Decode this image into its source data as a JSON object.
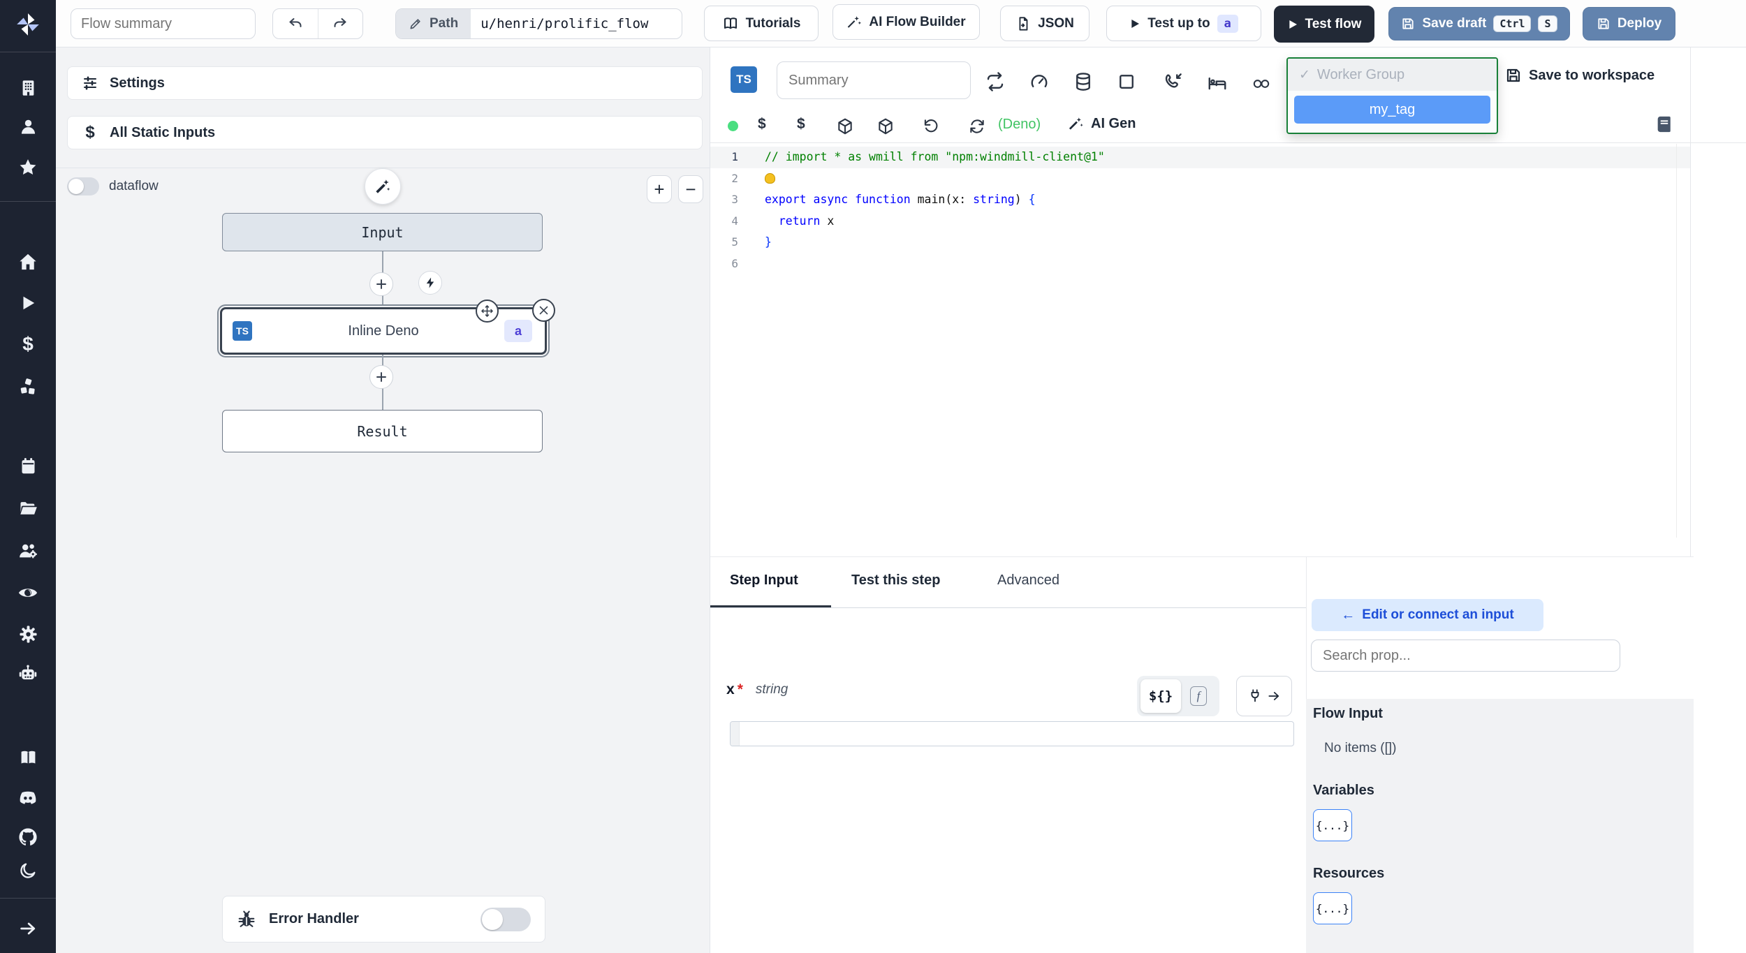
{
  "colors": {
    "sidebar_bg": "#1d2331",
    "ts_badge_blue": "#2f74c0",
    "steel_button": "#6283ae",
    "dark_button": "#222936",
    "selected_tag_blue": "#5b9bf8",
    "worker_group_border": "#188038",
    "deno_green": "#41c464",
    "status_dot_green": "#4ade80",
    "badge_indigo_bg": "#e0e7ff",
    "badge_indigo_text": "#4338ca",
    "edit_connect_bg": "#dbeafe",
    "edit_connect_text": "#1d4ed8"
  },
  "sidebar": {
    "icons": [
      "windmill-logo",
      "building",
      "person",
      "star",
      "home",
      "play",
      "dollar",
      "cubes",
      "calendar",
      "folder",
      "users-settings",
      "eye",
      "gear",
      "robot",
      "book",
      "discord",
      "github",
      "moon",
      "arrow-right"
    ]
  },
  "topbar": {
    "flow_summary_placeholder": "Flow summary",
    "path_label": "Path",
    "path_value": "u/henri/prolific_flow",
    "tutorials_label": "Tutorials",
    "ai_flow_builder_label": "AI Flow Builder",
    "json_label": "JSON",
    "test_up_to_label": "Test up to",
    "test_up_to_badge": "a",
    "test_flow_label": "Test flow",
    "save_draft_label": "Save draft",
    "save_draft_kbd": [
      "Ctrl",
      "S"
    ],
    "deploy_label": "Deploy"
  },
  "flow_panel": {
    "settings_label": "Settings",
    "static_inputs_label": "All Static Inputs",
    "dataflow_label": "dataflow",
    "zoom_in": "+",
    "zoom_out": "−",
    "input_node": "Input",
    "step_node": {
      "lang_badge": "TS",
      "label": "Inline Deno",
      "suffix_badge": "a"
    },
    "result_node": "Result",
    "error_handler_label": "Error Handler"
  },
  "editor": {
    "lang_badge": "TS",
    "summary_placeholder": "Summary",
    "lang_hint": "(Deno)",
    "ai_gen_label": "AI Gen",
    "save_to_workspace_label": "Save to workspace",
    "worker_group": {
      "check": "✓",
      "header": "Worker Group",
      "selected": "my_tag"
    },
    "code": {
      "lines": [
        [
          {
            "c": "cmt",
            "t": "// import * as wmill from \"npm:windmill-client@1\""
          }
        ],
        [
          {
            "c": "bulb",
            "t": ""
          }
        ],
        [
          {
            "c": "kw",
            "t": "export"
          },
          {
            "t": " "
          },
          {
            "c": "kw",
            "t": "async"
          },
          {
            "t": " "
          },
          {
            "c": "kw",
            "t": "function"
          },
          {
            "t": " "
          },
          {
            "t": "main"
          },
          {
            "c": "pun",
            "t": "("
          },
          {
            "t": "x"
          },
          {
            "c": "pun",
            "t": ": "
          },
          {
            "c": "kw",
            "t": "string"
          },
          {
            "c": "pun",
            "t": ")"
          },
          {
            "t": " "
          },
          {
            "c": "brc",
            "t": "{"
          }
        ],
        [
          {
            "t": "  "
          },
          {
            "c": "kw",
            "t": "return"
          },
          {
            "t": " x"
          }
        ],
        [
          {
            "c": "brc",
            "t": "}"
          }
        ],
        []
      ]
    }
  },
  "tabs": {
    "items": [
      {
        "label": "Step Input",
        "active": true
      },
      {
        "label": "Test this step",
        "active": false
      },
      {
        "label": "Advanced",
        "active": false
      }
    ]
  },
  "step_input": {
    "field_name": "x",
    "required_mark": "*",
    "field_type": "string",
    "expr_toggle": "${}",
    "fn_toggle": "f"
  },
  "connect_panel": {
    "edit_button_arrow": "←",
    "edit_button_label": "Edit or connect an input",
    "search_placeholder": "Search prop...",
    "sections": [
      {
        "title": "Flow Input",
        "empty": "No items ([])"
      },
      {
        "title": "Variables",
        "chip": "{...}"
      },
      {
        "title": "Resources",
        "chip": "{...}"
      }
    ]
  }
}
